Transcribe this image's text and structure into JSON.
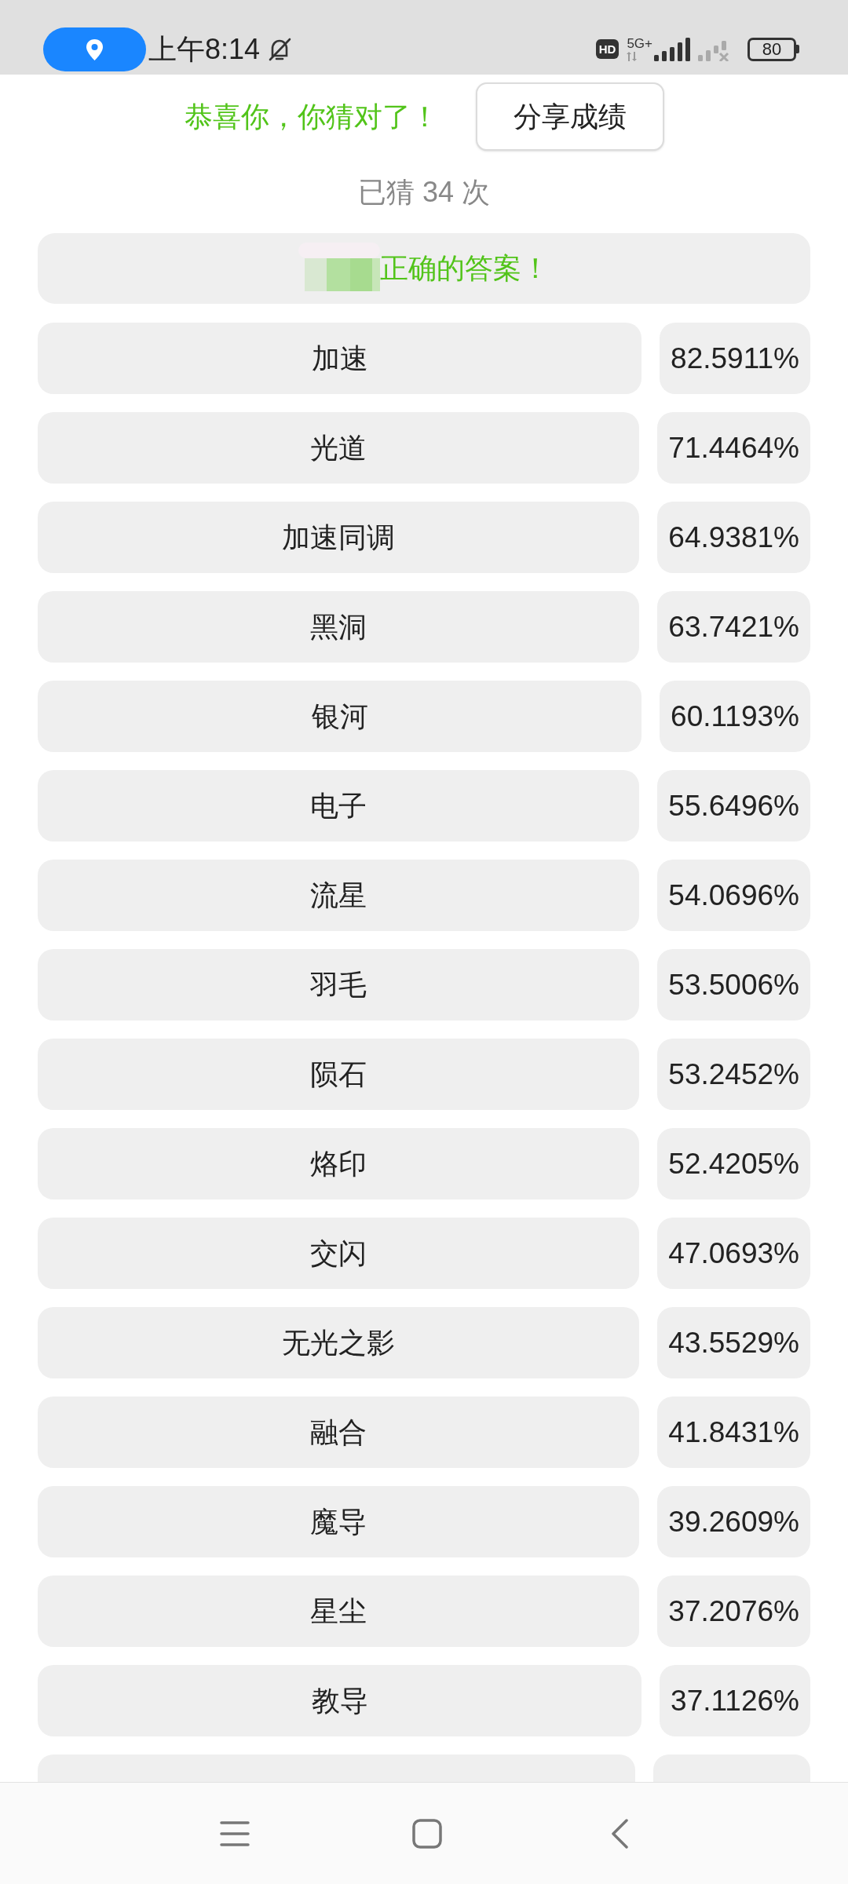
{
  "status_bar": {
    "time": "上午8:14",
    "hd_badge": "HD",
    "network": "5G+",
    "battery": "80"
  },
  "header": {
    "message": "恭喜你，你猜对了！",
    "share_button": "分享成绩"
  },
  "guess_count": "已猜 34 次",
  "answer_banner": {
    "text": "正确的答案！"
  },
  "rows": [
    {
      "kind": "entry",
      "word": "加速",
      "percent": "82.5911%"
    },
    {
      "kind": "entry",
      "word": "光道",
      "percent": "71.4464%"
    },
    {
      "kind": "entry",
      "word": "加速同调",
      "percent": "64.9381%"
    },
    {
      "kind": "entry",
      "word": "黑洞",
      "percent": "63.7421%"
    },
    {
      "kind": "entry",
      "word": "银河",
      "percent": "60.1193%"
    },
    {
      "kind": "entry",
      "word": "电子",
      "percent": "55.6496%"
    },
    {
      "kind": "entry",
      "word": "流星",
      "percent": "54.0696%"
    },
    {
      "kind": "entry",
      "word": "羽毛",
      "percent": "53.5006%"
    },
    {
      "kind": "entry",
      "word": "陨石",
      "percent": "53.2452%"
    },
    {
      "kind": "entry",
      "word": "烙印",
      "percent": "52.4205%"
    },
    {
      "kind": "entry",
      "word": "交闪",
      "percent": "47.0693%"
    },
    {
      "kind": "entry",
      "word": "无光之影",
      "percent": "43.5529%"
    },
    {
      "kind": "entry",
      "word": "融合",
      "percent": "41.8431%"
    },
    {
      "kind": "entry",
      "word": "魔导",
      "percent": "39.2609%"
    },
    {
      "kind": "entry",
      "word": "星尘",
      "percent": "37.2076%"
    },
    {
      "kind": "entry",
      "word": "教导",
      "percent": "37.1126%"
    },
    {
      "kind": "cut_off"
    }
  ]
}
